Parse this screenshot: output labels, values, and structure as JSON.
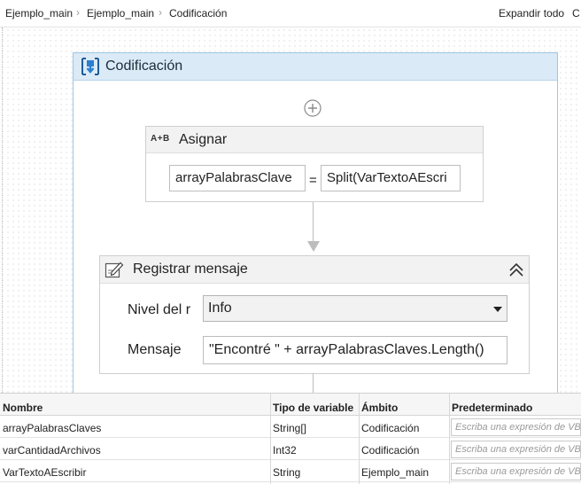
{
  "breadcrumb": {
    "items": [
      "Ejemplo_main",
      "Ejemplo_main",
      "Codificación"
    ],
    "separator": "›",
    "expand_all": "Expandir todo",
    "collapse_all": "C"
  },
  "sequence": {
    "title": "Codificación",
    "icon": "sequence-icon",
    "accent": "#dbeaf7"
  },
  "assign": {
    "title": "Asignar",
    "icon_text": "A+B",
    "left_value": "arrayPalabrasClave",
    "equals": "=",
    "right_value": "Split(VarTextoAEscri"
  },
  "log_message": {
    "title": "Registrar mensaje",
    "icon": "edit-log-icon",
    "level_label": "Nivel del r",
    "level_value": "Info",
    "message_label": "Mensaje",
    "message_value": "\"Encontré \" + arrayPalabrasClaves.Length()"
  },
  "variables": {
    "headers": [
      "Nombre",
      "Tipo de variable",
      "Ámbito",
      "Predeterminado"
    ],
    "rows": [
      {
        "name": "arrayPalabrasClaves",
        "type": "String[]",
        "scope": "Codificación",
        "default": "Escriba una expresión de VB"
      },
      {
        "name": "varCantidadArchivos",
        "type": "Int32",
        "scope": "Codificación",
        "default": "Escriba una expresión de VB"
      },
      {
        "name": "VarTextoAEscribir",
        "type": "String",
        "scope": "Ejemplo_main",
        "default": "Escriba una expresión de VB"
      }
    ]
  }
}
